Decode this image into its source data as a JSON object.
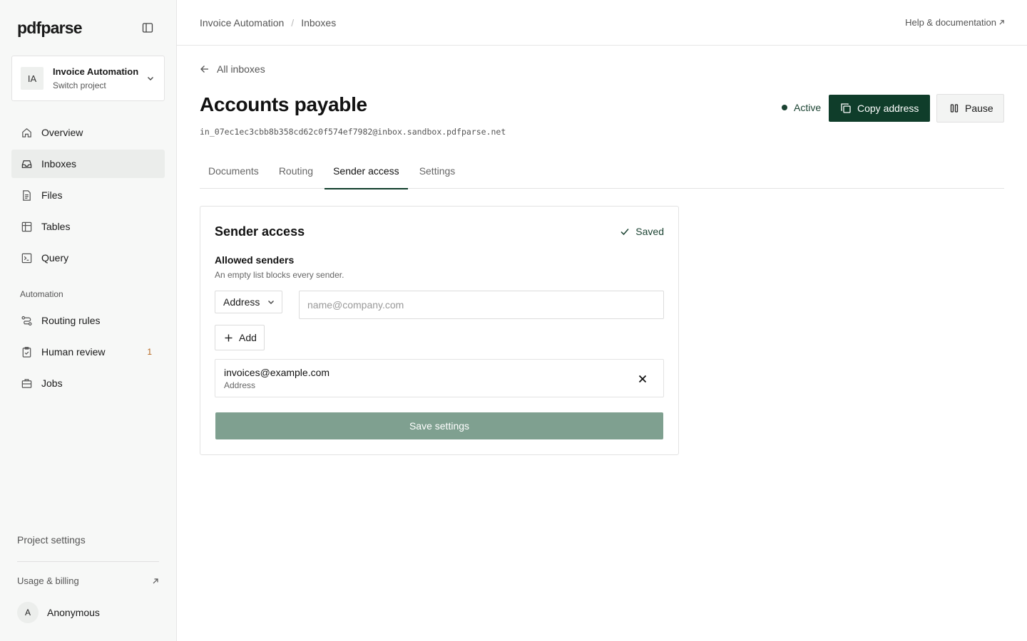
{
  "sidebar": {
    "logo": "pdfparse",
    "project": {
      "initials": "IA",
      "name": "Invoice Automation",
      "subtitle": "Switch project"
    },
    "nav_main": [
      {
        "label": "Overview",
        "icon": "home-icon"
      },
      {
        "label": "Inboxes",
        "icon": "inbox-icon",
        "active": true
      },
      {
        "label": "Files",
        "icon": "file-icon"
      },
      {
        "label": "Tables",
        "icon": "table-icon"
      },
      {
        "label": "Query",
        "icon": "terminal-icon"
      }
    ],
    "automation_label": "Automation",
    "nav_automation": [
      {
        "label": "Routing rules",
        "icon": "routing-icon"
      },
      {
        "label": "Human review",
        "icon": "clipboard-check-icon",
        "badge": "1"
      },
      {
        "label": "Jobs",
        "icon": "briefcase-icon"
      }
    ],
    "project_settings": "Project settings",
    "usage_billing": "Usage & billing",
    "user": {
      "initial": "A",
      "name": "Anonymous"
    }
  },
  "topbar": {
    "breadcrumb": [
      "Invoice Automation",
      "/",
      "Inboxes"
    ],
    "help": "Help & documentation"
  },
  "page": {
    "back_label": "All inboxes",
    "title": "Accounts payable",
    "address": "in_07ec1ec3cbb8b358cd62c0f574ef7982@inbox.sandbox.pdfparse.net",
    "status": "Active",
    "copy_label": "Copy address",
    "pause_label": "Pause",
    "tabs": [
      "Documents",
      "Routing",
      "Sender access",
      "Settings"
    ],
    "active_tab": "Sender access"
  },
  "sender_access": {
    "title": "Sender access",
    "saved_label": "Saved",
    "allowed_title": "Allowed senders",
    "allowed_hint": "An empty list blocks every sender.",
    "type_select": "Address",
    "input_placeholder": "name@company.com",
    "add_label": "Add",
    "senders": [
      {
        "email": "invoices@example.com",
        "type": "Address"
      }
    ],
    "save_label": "Save settings"
  },
  "colors": {
    "primary": "#0f3d2a",
    "save_disabled": "#7fa090",
    "badge": "#b5651d"
  }
}
